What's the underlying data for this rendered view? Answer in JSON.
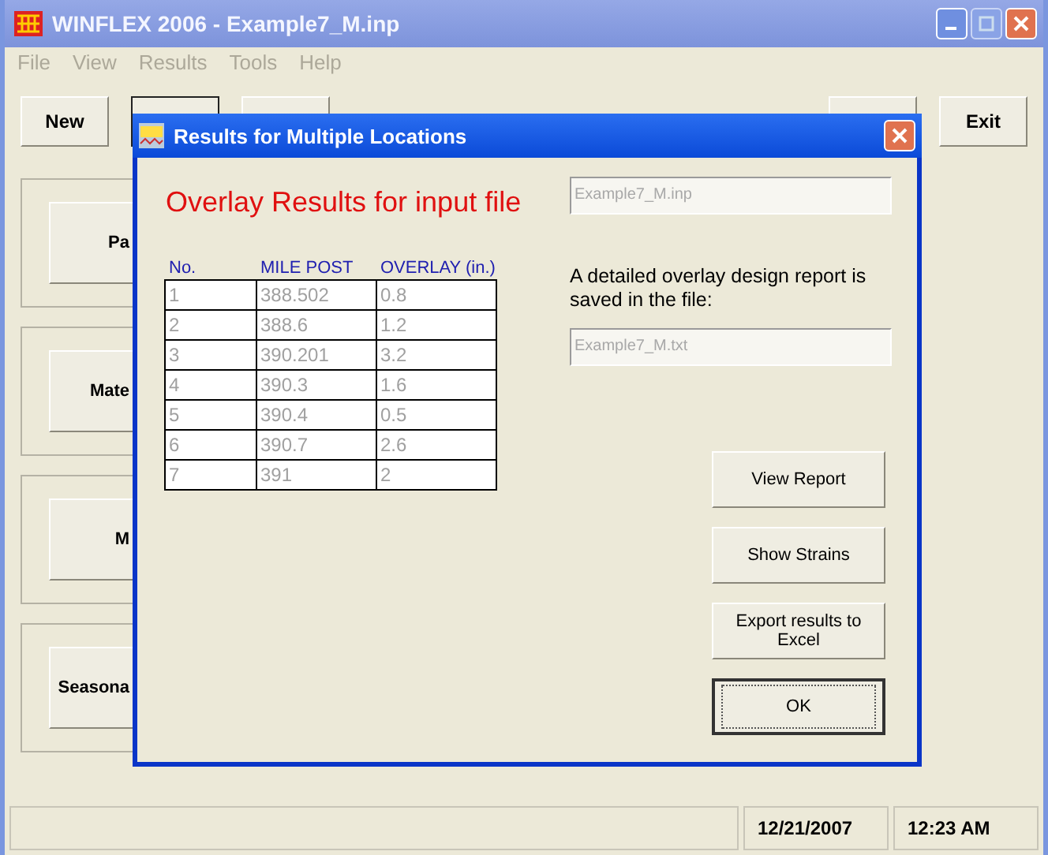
{
  "window": {
    "title": "WINFLEX 2006 - Example7_M.inp"
  },
  "menu": [
    "File",
    "View",
    "Results",
    "Tools",
    "Help"
  ],
  "toolbar": {
    "left_button": "New",
    "right_button": "Exit"
  },
  "side_buttons": [
    "Pa",
    "Mate",
    "M",
    "Seasona"
  ],
  "status_bar": {
    "date": "12/21/2007",
    "time": "12:23 AM"
  },
  "dialog": {
    "title": "Results for Multiple Locations",
    "heading": "Overlay Results for input file",
    "input_file": "Example7_M.inp",
    "note": "A detailed overlay design report is saved in the file:",
    "report_file": "Example7_M.txt",
    "table": {
      "columns": [
        "No.",
        "MILE POST",
        "OVERLAY (in.)"
      ],
      "rows": [
        [
          "1",
          "388.502",
          "0.8"
        ],
        [
          "2",
          "388.6",
          "1.2"
        ],
        [
          "3",
          "390.201",
          "3.2"
        ],
        [
          "4",
          "390.3",
          "1.6"
        ],
        [
          "5",
          "390.4",
          "0.5"
        ],
        [
          "6",
          "390.7",
          "2.6"
        ],
        [
          "7",
          "391",
          "2"
        ]
      ]
    },
    "buttons": [
      {
        "label": "View Report",
        "default": false
      },
      {
        "label": "Show Strains",
        "default": false
      },
      {
        "label": "Export results to Excel",
        "default": false
      },
      {
        "label": "OK",
        "default": true
      }
    ]
  }
}
